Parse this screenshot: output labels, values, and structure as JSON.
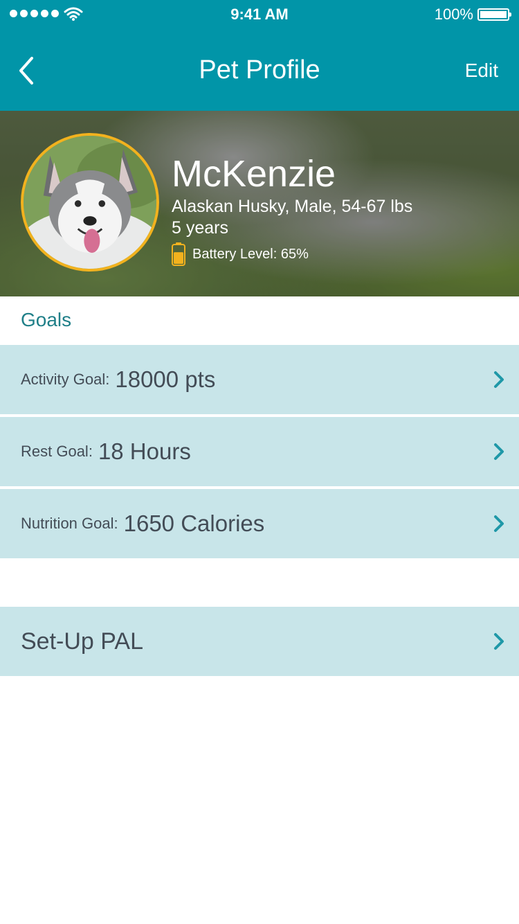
{
  "status_bar": {
    "time": "9:41 AM",
    "battery_percent": "100%"
  },
  "nav": {
    "title": "Pet Profile",
    "edit_label": "Edit"
  },
  "pet": {
    "name": "McKenzie",
    "breed_line": "Alaskan Husky, Male, 54-67 lbs",
    "age": "5 years",
    "battery_label": "Battery Level: 65%",
    "battery_level": 0.65
  },
  "goals": {
    "section_title": "Goals",
    "items": [
      {
        "label": "Activity Goal:",
        "value": "18000 pts"
      },
      {
        "label": "Rest Goal:",
        "value": "18 Hours"
      },
      {
        "label": "Nutrition Goal:",
        "value": "1650 Calories"
      }
    ]
  },
  "setup": {
    "label": "Set-Up PAL"
  },
  "colors": {
    "primary": "#0195a8",
    "row_bg": "#c8e5e9",
    "accent": "#f2b21e",
    "section_text": "#1f7f88"
  }
}
